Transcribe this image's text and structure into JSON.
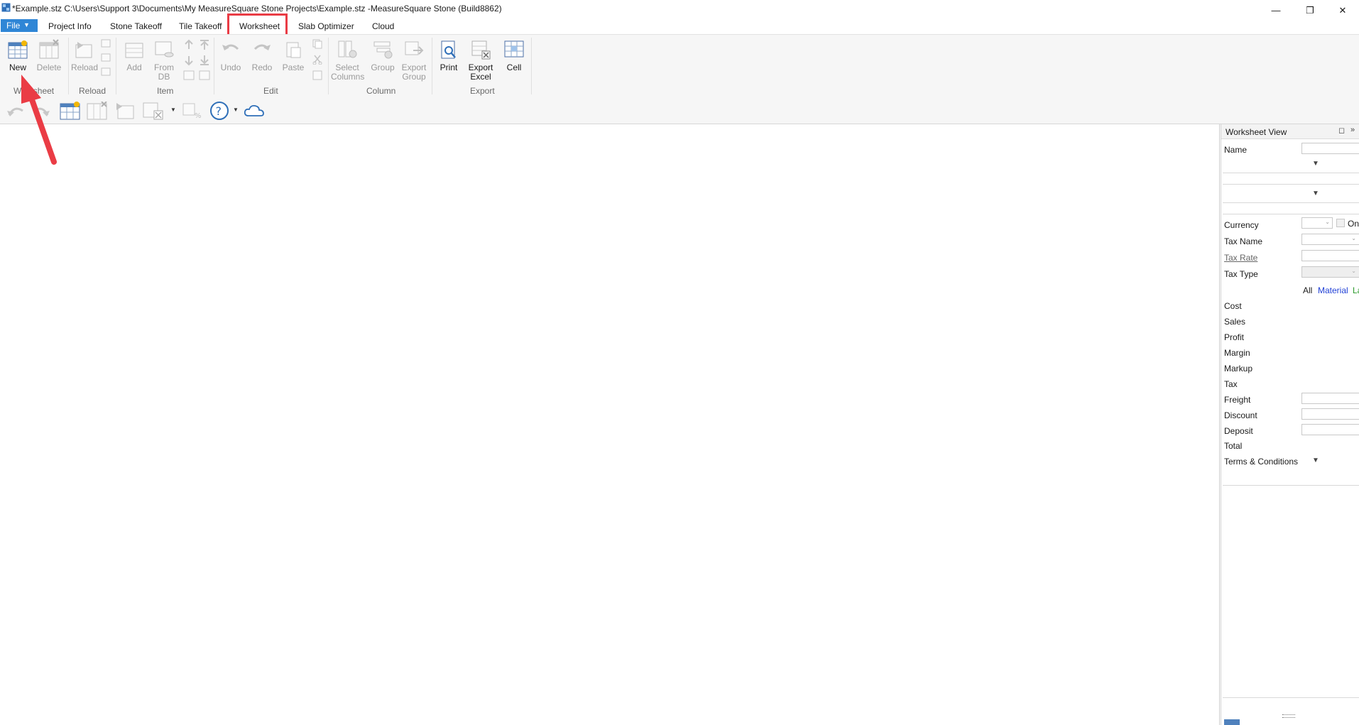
{
  "window": {
    "title": "*Example.stz C:\\Users\\Support 3\\Documents\\My MeasureSquare Stone Projects\\Example.stz -MeasureSquare Stone (Build8862)",
    "controls": {
      "minimize": "—",
      "restore": "❐",
      "close": "✕"
    }
  },
  "menu": {
    "file_label": "File",
    "items": [
      "Project Info",
      "Stone Takeoff",
      "Tile Takeoff",
      "Worksheet",
      "Slab Optimizer",
      "Cloud"
    ],
    "active": "Worksheet"
  },
  "ribbon": {
    "buttons": {
      "new": "New",
      "delete": "Delete",
      "reload": "Reload",
      "add": "Add",
      "from_db_1": "From",
      "from_db_2": "DB",
      "undo": "Undo",
      "redo": "Redo",
      "paste": "Paste",
      "select_columns_1": "Select",
      "select_columns_2": "Columns",
      "group": "Group",
      "export_group_1": "Export",
      "export_group_2": "Group",
      "print": "Print",
      "export_excel_1": "Export",
      "export_excel_2": "Excel",
      "cell": "Cell"
    },
    "groups": {
      "worksheet": "Worksheet",
      "reload": "Reload",
      "item": "Item",
      "edit": "Edit",
      "column": "Column",
      "export": "Export"
    }
  },
  "worksheet_view": {
    "title": "Worksheet View",
    "name_label": "Name",
    "currency_label": "Currency",
    "currency_checkbox_label": "On",
    "tax_name_label": "Tax Name",
    "tax_rate_label": "Tax Rate",
    "tax_type_label": "Tax Type",
    "filters": [
      "All",
      "Material",
      "La"
    ],
    "filter_colors": [
      "#1a1a1a",
      "#1f3fd6",
      "#2a9a2a"
    ],
    "rows": [
      "Cost",
      "Sales",
      "Profit",
      "Margin",
      "Markup",
      "Tax",
      "Freight",
      "Discount",
      "Deposit",
      "Total"
    ],
    "terms_label": "Terms & Conditions"
  },
  "colors": {
    "accent": "#2f86d6",
    "highlight_box": "#ea3c45",
    "arrow": "#ea3c45"
  }
}
